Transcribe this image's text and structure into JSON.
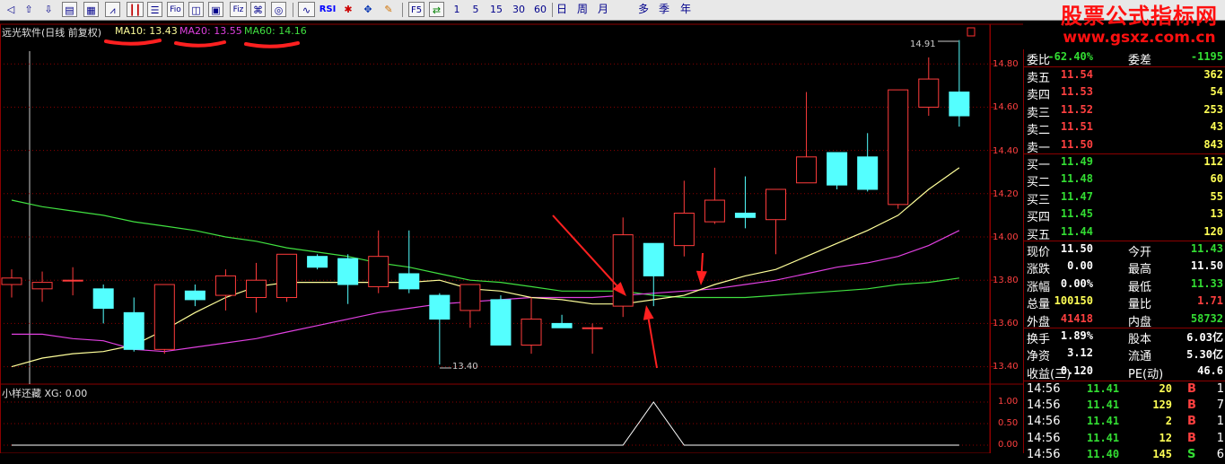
{
  "toolbar": {
    "periods": [
      "1",
      "5",
      "15",
      "30",
      "60"
    ],
    "cycles": [
      "日",
      "周",
      "月",
      "多",
      "季",
      "年"
    ],
    "labels": {
      "rsi": "RSI",
      "f5": "F5"
    }
  },
  "watermark": {
    "title": "股票公式指标网",
    "url": "www.gsxz.com.cn"
  },
  "chart": {
    "title": "远光软件(日线 前复权)",
    "ma10_label": "MA10: 13.43",
    "ma20_label": "MA20: 13.55",
    "ma60_label": "MA60: 14.16",
    "high_label": "14.91",
    "low_label": "13.40",
    "price_ticks": [
      "14.80",
      "14.60",
      "14.40",
      "14.20",
      "14.00",
      "13.80",
      "13.60",
      "13.40"
    ],
    "colors": {
      "up": "#ff3c3c",
      "down": "#54ffff",
      "ma10": "#ffff9a",
      "ma20": "#e040e0",
      "ma60": "#40e040",
      "annotation": "#ff2020",
      "grid": "#8b0000"
    }
  },
  "chart_data": [
    {
      "type": "candlestick",
      "title": "远光软件(日线 前复权)",
      "ylim": [
        13.34,
        14.97
      ],
      "candles": [
        {
          "o": 13.78,
          "c": 13.81,
          "h": 13.85,
          "l": 13.72
        },
        {
          "o": 13.76,
          "c": 13.79,
          "h": 13.84,
          "l": 13.7
        },
        {
          "o": 13.8,
          "c": 13.8,
          "h": 13.86,
          "l": 13.73
        },
        {
          "o": 13.76,
          "c": 13.67,
          "h": 13.78,
          "l": 13.6
        },
        {
          "o": 13.65,
          "c": 13.48,
          "h": 13.72,
          "l": 13.47
        },
        {
          "o": 13.48,
          "c": 13.78,
          "h": 13.78,
          "l": 13.46
        },
        {
          "o": 13.75,
          "c": 13.71,
          "h": 13.78,
          "l": 13.68
        },
        {
          "o": 13.73,
          "c": 13.82,
          "h": 13.85,
          "l": 13.66
        },
        {
          "o": 13.72,
          "c": 13.8,
          "h": 13.88,
          "l": 13.65
        },
        {
          "o": 13.72,
          "c": 13.92,
          "h": 13.92,
          "l": 13.7
        },
        {
          "o": 13.91,
          "c": 13.86,
          "h": 13.92,
          "l": 13.85
        },
        {
          "o": 13.9,
          "c": 13.78,
          "h": 13.92,
          "l": 13.69
        },
        {
          "o": 13.77,
          "c": 13.91,
          "h": 14.03,
          "l": 13.74
        },
        {
          "o": 13.83,
          "c": 13.76,
          "h": 14.03,
          "l": 13.74
        },
        {
          "o": 13.73,
          "c": 13.62,
          "h": 13.74,
          "l": 13.41
        },
        {
          "o": 13.66,
          "c": 13.78,
          "h": 13.78,
          "l": 13.58
        },
        {
          "o": 13.71,
          "c": 13.5,
          "h": 13.73,
          "l": 13.5
        },
        {
          "o": 13.5,
          "c": 13.62,
          "h": 13.72,
          "l": 13.46
        },
        {
          "o": 13.6,
          "c": 13.58,
          "h": 13.64,
          "l": 13.58
        },
        {
          "o": 13.58,
          "c": 13.58,
          "h": 13.6,
          "l": 13.46
        },
        {
          "o": 13.68,
          "c": 14.01,
          "h": 14.09,
          "l": 13.63
        },
        {
          "o": 13.97,
          "c": 13.82,
          "h": 13.97,
          "l": 13.68
        },
        {
          "o": 13.96,
          "c": 14.11,
          "h": 14.26,
          "l": 13.91
        },
        {
          "o": 14.07,
          "c": 14.17,
          "h": 14.32,
          "l": 14.06
        },
        {
          "o": 14.11,
          "c": 14.09,
          "h": 14.28,
          "l": 14.04
        },
        {
          "o": 14.08,
          "c": 14.22,
          "h": 14.22,
          "l": 13.92
        },
        {
          "o": 14.25,
          "c": 14.37,
          "h": 14.67,
          "l": 14.25
        },
        {
          "o": 14.39,
          "c": 14.24,
          "h": 14.39,
          "l": 14.22
        },
        {
          "o": 14.37,
          "c": 14.22,
          "h": 14.48,
          "l": 14.21
        },
        {
          "o": 14.15,
          "c": 14.68,
          "h": 14.68,
          "l": 14.13
        },
        {
          "o": 14.6,
          "c": 14.73,
          "h": 14.83,
          "l": 14.56
        },
        {
          "o": 14.67,
          "c": 14.56,
          "h": 14.91,
          "l": 14.51
        }
      ],
      "ma10": [
        13.4,
        13.44,
        13.46,
        13.47,
        13.5,
        13.57,
        13.65,
        13.72,
        13.77,
        13.79,
        13.79,
        13.79,
        13.79,
        13.79,
        13.8,
        13.76,
        13.75,
        13.72,
        13.71,
        13.69,
        13.69,
        13.71,
        13.73,
        13.78,
        13.82,
        13.85,
        13.91,
        13.97,
        14.03,
        14.1,
        14.22,
        14.32
      ],
      "ma20": [
        13.55,
        13.55,
        13.53,
        13.52,
        13.48,
        13.47,
        13.49,
        13.51,
        13.53,
        13.56,
        13.59,
        13.62,
        13.65,
        13.67,
        13.69,
        13.7,
        13.71,
        13.72,
        13.72,
        13.72,
        13.73,
        13.74,
        13.75,
        13.76,
        13.78,
        13.8,
        13.83,
        13.86,
        13.88,
        13.91,
        13.96,
        14.03
      ],
      "ma60": [
        14.17,
        14.14,
        14.12,
        14.1,
        14.07,
        14.05,
        14.03,
        14.0,
        13.98,
        13.95,
        13.93,
        13.91,
        13.88,
        13.86,
        13.83,
        13.8,
        13.79,
        13.77,
        13.75,
        13.75,
        13.75,
        13.73,
        13.72,
        13.72,
        13.72,
        13.73,
        13.74,
        13.75,
        13.76,
        13.78,
        13.79,
        13.81
      ]
    },
    {
      "type": "line",
      "title": "小样还藏 XG: 0.00",
      "y_ticks": [
        "1.00",
        "0.50",
        "0.00"
      ],
      "ylim": [
        0,
        1
      ],
      "values": [
        0,
        0,
        0,
        0,
        0,
        0,
        0,
        0,
        0,
        0,
        0,
        0,
        0,
        0,
        0,
        0,
        0,
        0,
        0,
        0,
        0,
        1,
        0,
        0,
        0,
        0,
        0,
        0,
        0,
        0,
        0,
        0
      ]
    }
  ],
  "indicator": {
    "title": "小样还藏 XG: 0.00"
  },
  "panel": {
    "wei_bi": {
      "label": "委比",
      "value": "-62.40%",
      "label2": "委差",
      "value2": "-1195"
    },
    "asks": [
      {
        "label": "卖五",
        "price": "11.54",
        "vol": "362"
      },
      {
        "label": "卖四",
        "price": "11.53",
        "vol": "54"
      },
      {
        "label": "卖三",
        "price": "11.52",
        "vol": "253"
      },
      {
        "label": "卖二",
        "price": "11.51",
        "vol": "43"
      },
      {
        "label": "卖一",
        "price": "11.50",
        "vol": "843"
      }
    ],
    "bids": [
      {
        "label": "买一",
        "price": "11.49",
        "vol": "112"
      },
      {
        "label": "买二",
        "price": "11.48",
        "vol": "60"
      },
      {
        "label": "买三",
        "price": "11.47",
        "vol": "55"
      },
      {
        "label": "买四",
        "price": "11.45",
        "vol": "13"
      },
      {
        "label": "买五",
        "price": "11.44",
        "vol": "120"
      }
    ],
    "quote": [
      {
        "l1": "现价",
        "v1": "11.50",
        "c1": "white",
        "l2": "今开",
        "v2": "11.43",
        "c2": "green"
      },
      {
        "l1": "涨跌",
        "v1": "0.00",
        "c1": "white",
        "l2": "最高",
        "v2": "11.50",
        "c2": "white"
      },
      {
        "l1": "涨幅",
        "v1": "0.00%",
        "c1": "white",
        "l2": "最低",
        "v2": "11.33",
        "c2": "green"
      },
      {
        "l1": "总量",
        "v1": "100150",
        "c1": "yellow",
        "l2": "量比",
        "v2": "1.71",
        "c2": "red"
      },
      {
        "l1": "外盘",
        "v1": "41418",
        "c1": "red",
        "l2": "内盘",
        "v2": "58732",
        "c2": "green"
      }
    ],
    "stats": [
      {
        "l1": "换手",
        "v1": "1.89%",
        "l2": "股本",
        "v2": "6.03亿"
      },
      {
        "l1": "净资",
        "v1": "3.12",
        "l2": "流通",
        "v2": "5.30亿"
      },
      {
        "l1": "收益(三)",
        "v1": "0.120",
        "l2": "PE(动)",
        "v2": "46.6"
      }
    ],
    "ticks": [
      {
        "time": "14:56",
        "price": "11.41",
        "vol": "20",
        "side": "B",
        "n": "1"
      },
      {
        "time": "14:56",
        "price": "11.41",
        "vol": "129",
        "side": "B",
        "n": "7"
      },
      {
        "time": "14:56",
        "price": "11.41",
        "vol": "2",
        "side": "B",
        "n": "1"
      },
      {
        "time": "14:56",
        "price": "11.41",
        "vol": "12",
        "side": "B",
        "n": "1"
      },
      {
        "time": "14:56",
        "price": "11.40",
        "vol": "145",
        "side": "S",
        "n": "6"
      }
    ]
  }
}
